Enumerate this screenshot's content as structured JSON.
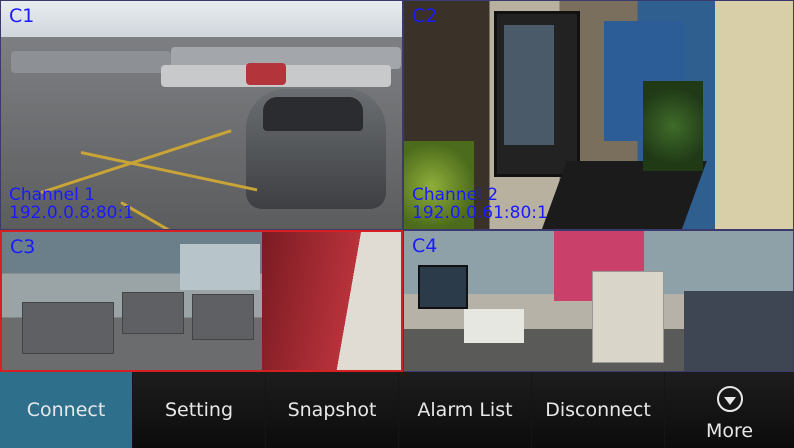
{
  "cameras": [
    {
      "label": "C1",
      "channel": "Channel 1",
      "address": "192.0.0.8:80:1",
      "selected": false
    },
    {
      "label": "C2",
      "channel": "Channel 2",
      "address": "192.0.0.61:80:1",
      "selected": false
    },
    {
      "label": "C3",
      "selected": true
    },
    {
      "label": "C4",
      "selected": false
    }
  ],
  "toolbar": {
    "connect": "Connect",
    "setting": "Setting",
    "snapshot": "Snapshot",
    "alarm_list": "Alarm List",
    "disconnect": "Disconnect",
    "more": "More",
    "more_icon": "chevron-down-circle-icon"
  },
  "colors": {
    "label_text": "#1a1aff",
    "selected_border": "#d42020",
    "active_button": "#2e6f8c"
  }
}
